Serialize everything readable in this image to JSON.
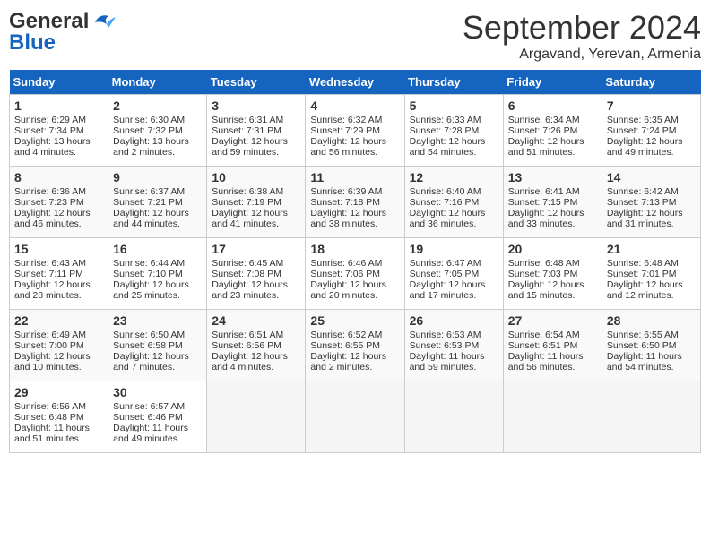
{
  "header": {
    "logo_line1": "General",
    "logo_line2": "Blue",
    "month": "September 2024",
    "location": "Argavand, Yerevan, Armenia"
  },
  "days_of_week": [
    "Sunday",
    "Monday",
    "Tuesday",
    "Wednesday",
    "Thursday",
    "Friday",
    "Saturday"
  ],
  "weeks": [
    [
      {
        "day": 1,
        "sunrise": "6:29 AM",
        "sunset": "7:34 PM",
        "daylight": "13 hours and 4 minutes."
      },
      {
        "day": 2,
        "sunrise": "6:30 AM",
        "sunset": "7:32 PM",
        "daylight": "13 hours and 2 minutes."
      },
      {
        "day": 3,
        "sunrise": "6:31 AM",
        "sunset": "7:31 PM",
        "daylight": "12 hours and 59 minutes."
      },
      {
        "day": 4,
        "sunrise": "6:32 AM",
        "sunset": "7:29 PM",
        "daylight": "12 hours and 56 minutes."
      },
      {
        "day": 5,
        "sunrise": "6:33 AM",
        "sunset": "7:28 PM",
        "daylight": "12 hours and 54 minutes."
      },
      {
        "day": 6,
        "sunrise": "6:34 AM",
        "sunset": "7:26 PM",
        "daylight": "12 hours and 51 minutes."
      },
      {
        "day": 7,
        "sunrise": "6:35 AM",
        "sunset": "7:24 PM",
        "daylight": "12 hours and 49 minutes."
      }
    ],
    [
      {
        "day": 8,
        "sunrise": "6:36 AM",
        "sunset": "7:23 PM",
        "daylight": "12 hours and 46 minutes."
      },
      {
        "day": 9,
        "sunrise": "6:37 AM",
        "sunset": "7:21 PM",
        "daylight": "12 hours and 44 minutes."
      },
      {
        "day": 10,
        "sunrise": "6:38 AM",
        "sunset": "7:19 PM",
        "daylight": "12 hours and 41 minutes."
      },
      {
        "day": 11,
        "sunrise": "6:39 AM",
        "sunset": "7:18 PM",
        "daylight": "12 hours and 38 minutes."
      },
      {
        "day": 12,
        "sunrise": "6:40 AM",
        "sunset": "7:16 PM",
        "daylight": "12 hours and 36 minutes."
      },
      {
        "day": 13,
        "sunrise": "6:41 AM",
        "sunset": "7:15 PM",
        "daylight": "12 hours and 33 minutes."
      },
      {
        "day": 14,
        "sunrise": "6:42 AM",
        "sunset": "7:13 PM",
        "daylight": "12 hours and 31 minutes."
      }
    ],
    [
      {
        "day": 15,
        "sunrise": "6:43 AM",
        "sunset": "7:11 PM",
        "daylight": "12 hours and 28 minutes."
      },
      {
        "day": 16,
        "sunrise": "6:44 AM",
        "sunset": "7:10 PM",
        "daylight": "12 hours and 25 minutes."
      },
      {
        "day": 17,
        "sunrise": "6:45 AM",
        "sunset": "7:08 PM",
        "daylight": "12 hours and 23 minutes."
      },
      {
        "day": 18,
        "sunrise": "6:46 AM",
        "sunset": "7:06 PM",
        "daylight": "12 hours and 20 minutes."
      },
      {
        "day": 19,
        "sunrise": "6:47 AM",
        "sunset": "7:05 PM",
        "daylight": "12 hours and 17 minutes."
      },
      {
        "day": 20,
        "sunrise": "6:48 AM",
        "sunset": "7:03 PM",
        "daylight": "12 hours and 15 minutes."
      },
      {
        "day": 21,
        "sunrise": "6:48 AM",
        "sunset": "7:01 PM",
        "daylight": "12 hours and 12 minutes."
      }
    ],
    [
      {
        "day": 22,
        "sunrise": "6:49 AM",
        "sunset": "7:00 PM",
        "daylight": "12 hours and 10 minutes."
      },
      {
        "day": 23,
        "sunrise": "6:50 AM",
        "sunset": "6:58 PM",
        "daylight": "12 hours and 7 minutes."
      },
      {
        "day": 24,
        "sunrise": "6:51 AM",
        "sunset": "6:56 PM",
        "daylight": "12 hours and 4 minutes."
      },
      {
        "day": 25,
        "sunrise": "6:52 AM",
        "sunset": "6:55 PM",
        "daylight": "12 hours and 2 minutes."
      },
      {
        "day": 26,
        "sunrise": "6:53 AM",
        "sunset": "6:53 PM",
        "daylight": "11 hours and 59 minutes."
      },
      {
        "day": 27,
        "sunrise": "6:54 AM",
        "sunset": "6:51 PM",
        "daylight": "11 hours and 56 minutes."
      },
      {
        "day": 28,
        "sunrise": "6:55 AM",
        "sunset": "6:50 PM",
        "daylight": "11 hours and 54 minutes."
      }
    ],
    [
      {
        "day": 29,
        "sunrise": "6:56 AM",
        "sunset": "6:48 PM",
        "daylight": "11 hours and 51 minutes."
      },
      {
        "day": 30,
        "sunrise": "6:57 AM",
        "sunset": "6:46 PM",
        "daylight": "11 hours and 49 minutes."
      },
      null,
      null,
      null,
      null,
      null
    ]
  ]
}
